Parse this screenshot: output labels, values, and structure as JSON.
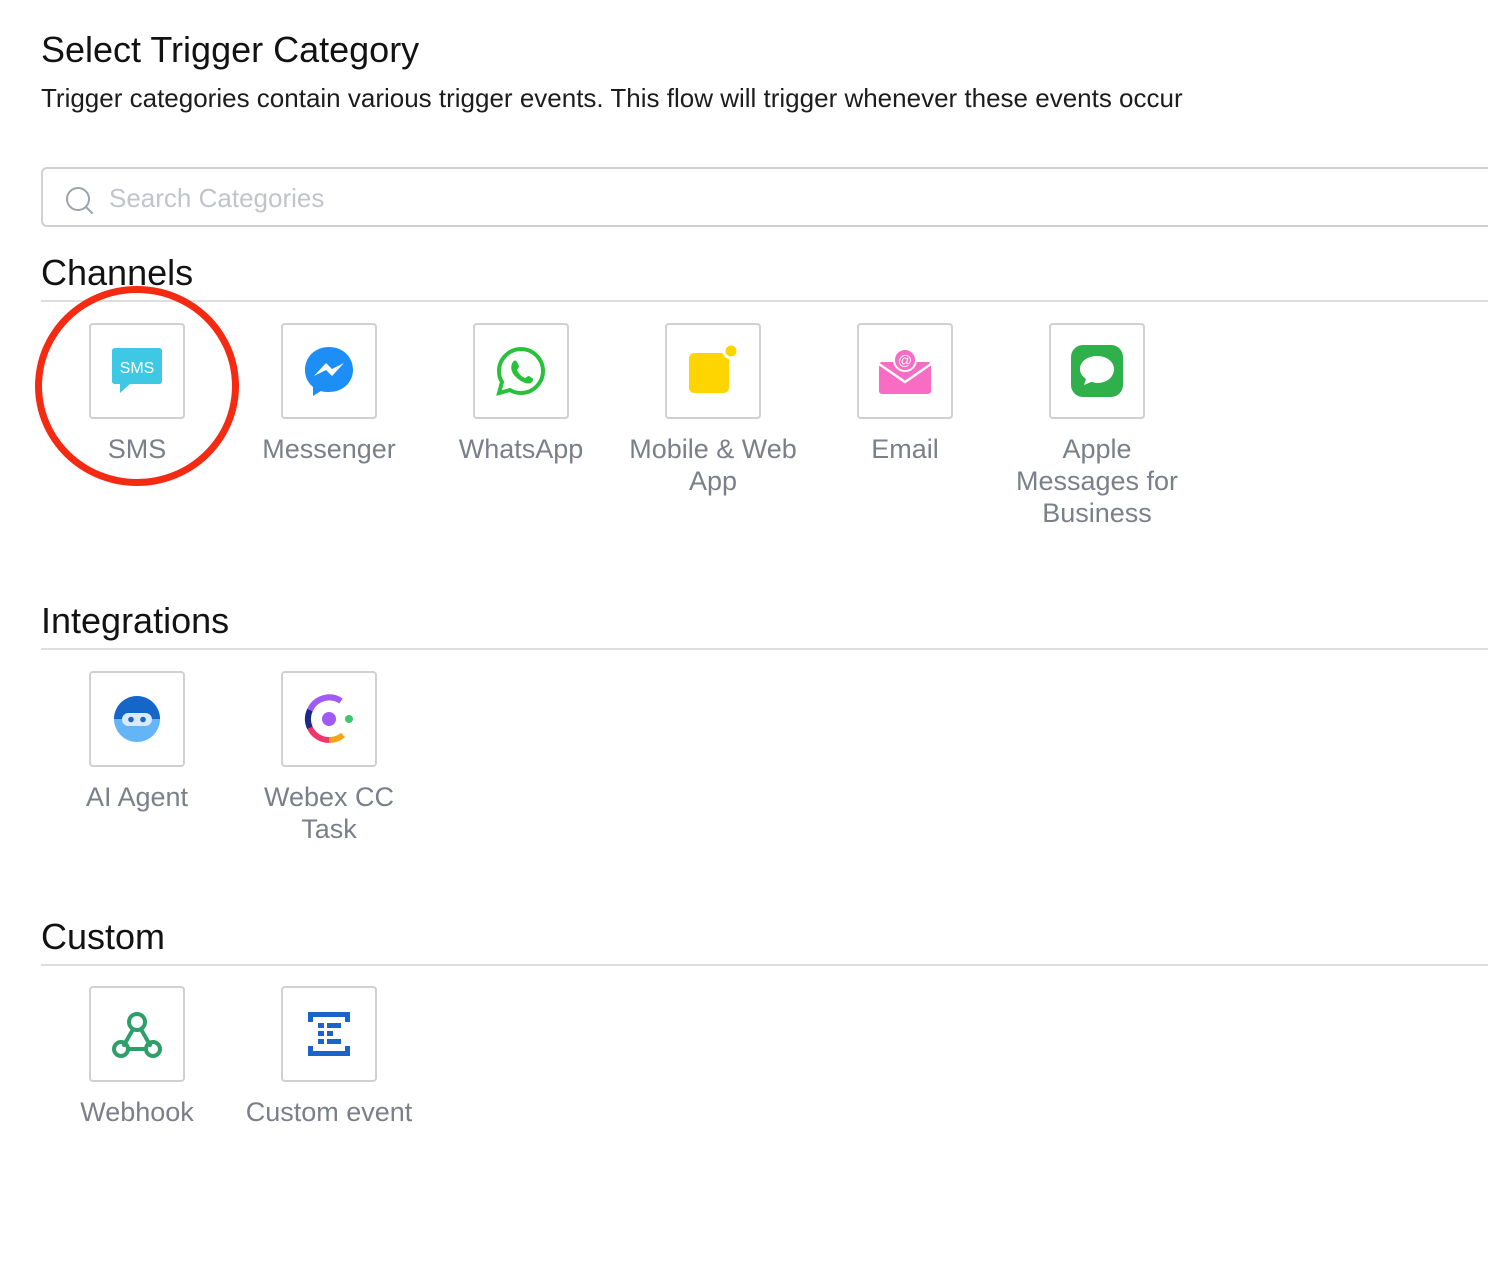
{
  "header": {
    "title": "Select Trigger Category",
    "subtitle": "Trigger categories contain various trigger events. This flow will trigger whenever these events occur"
  },
  "search": {
    "placeholder": "Search Categories",
    "value": ""
  },
  "sections": {
    "channels": {
      "heading": "Channels",
      "items": [
        {
          "label": "SMS",
          "icon": "sms-icon",
          "color": "#3fc8e4"
        },
        {
          "label": "Messenger",
          "icon": "messenger-icon",
          "color": "#1e8ef7"
        },
        {
          "label": "WhatsApp",
          "icon": "whatsapp-icon",
          "color": "#27c13a"
        },
        {
          "label": "Mobile & Web App",
          "icon": "mobile-web-app-icon",
          "color": "#ffd500"
        },
        {
          "label": "Email",
          "icon": "email-icon",
          "color": "#f86cc4"
        },
        {
          "label": "Apple Messages for Business",
          "icon": "apple-messages-icon",
          "color": "#2fb04a"
        }
      ]
    },
    "integrations": {
      "heading": "Integrations",
      "items": [
        {
          "label": "AI Agent",
          "icon": "ai-agent-icon",
          "color": "#1466c8"
        },
        {
          "label": "Webex CC Task",
          "icon": "webex-cc-icon",
          "color": "#a05bf5"
        }
      ]
    },
    "custom": {
      "heading": "Custom",
      "items": [
        {
          "label": "Webhook",
          "icon": "webhook-icon",
          "color": "#2e9e6a"
        },
        {
          "label": "Custom event",
          "icon": "custom-event-icon",
          "color": "#1a63c9"
        }
      ]
    }
  },
  "annotation": {
    "highlight_color": "#f42a12",
    "highlighted_item": "SMS"
  }
}
